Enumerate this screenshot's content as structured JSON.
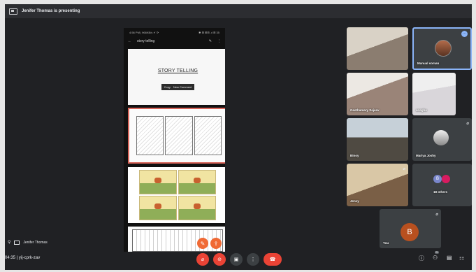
{
  "topbar": {
    "presenting": "Jenifer Thomas is presenting"
  },
  "phone": {
    "status_left": "4:56 PM | 966KB/s ✔ ⟳",
    "status_right": "✱ ⊞ ⊞⊞ .ıl ⊞ 35",
    "screen_title": "story telling",
    "page_title": "STORY TELLING",
    "context_menu": [
      "Copy",
      "New Comment"
    ]
  },
  "participants": [
    {
      "name": "",
      "mic_muted": false
    },
    {
      "name": "Manual soman",
      "mic_muted": false
    },
    {
      "name": "Geethamary Sajeev",
      "mic_muted": false
    },
    {
      "name": "anagha",
      "mic_muted": true
    },
    {
      "name": "Binoy",
      "mic_muted": false
    },
    {
      "name": "Mariya Joshy",
      "mic_muted": true
    },
    {
      "name": "Jency",
      "mic_muted": true
    },
    {
      "name": "18 others",
      "mic_muted": false
    },
    {
      "name": "You",
      "mic_muted": true
    }
  ],
  "you_avatar_letter": "B",
  "others_avatar_letter": "B",
  "presenter_label": "Jenifer Thomas",
  "meeting": {
    "time": "04:35",
    "separator": "|",
    "code": "yij-cprk-zav"
  },
  "others_count_badge": "21"
}
